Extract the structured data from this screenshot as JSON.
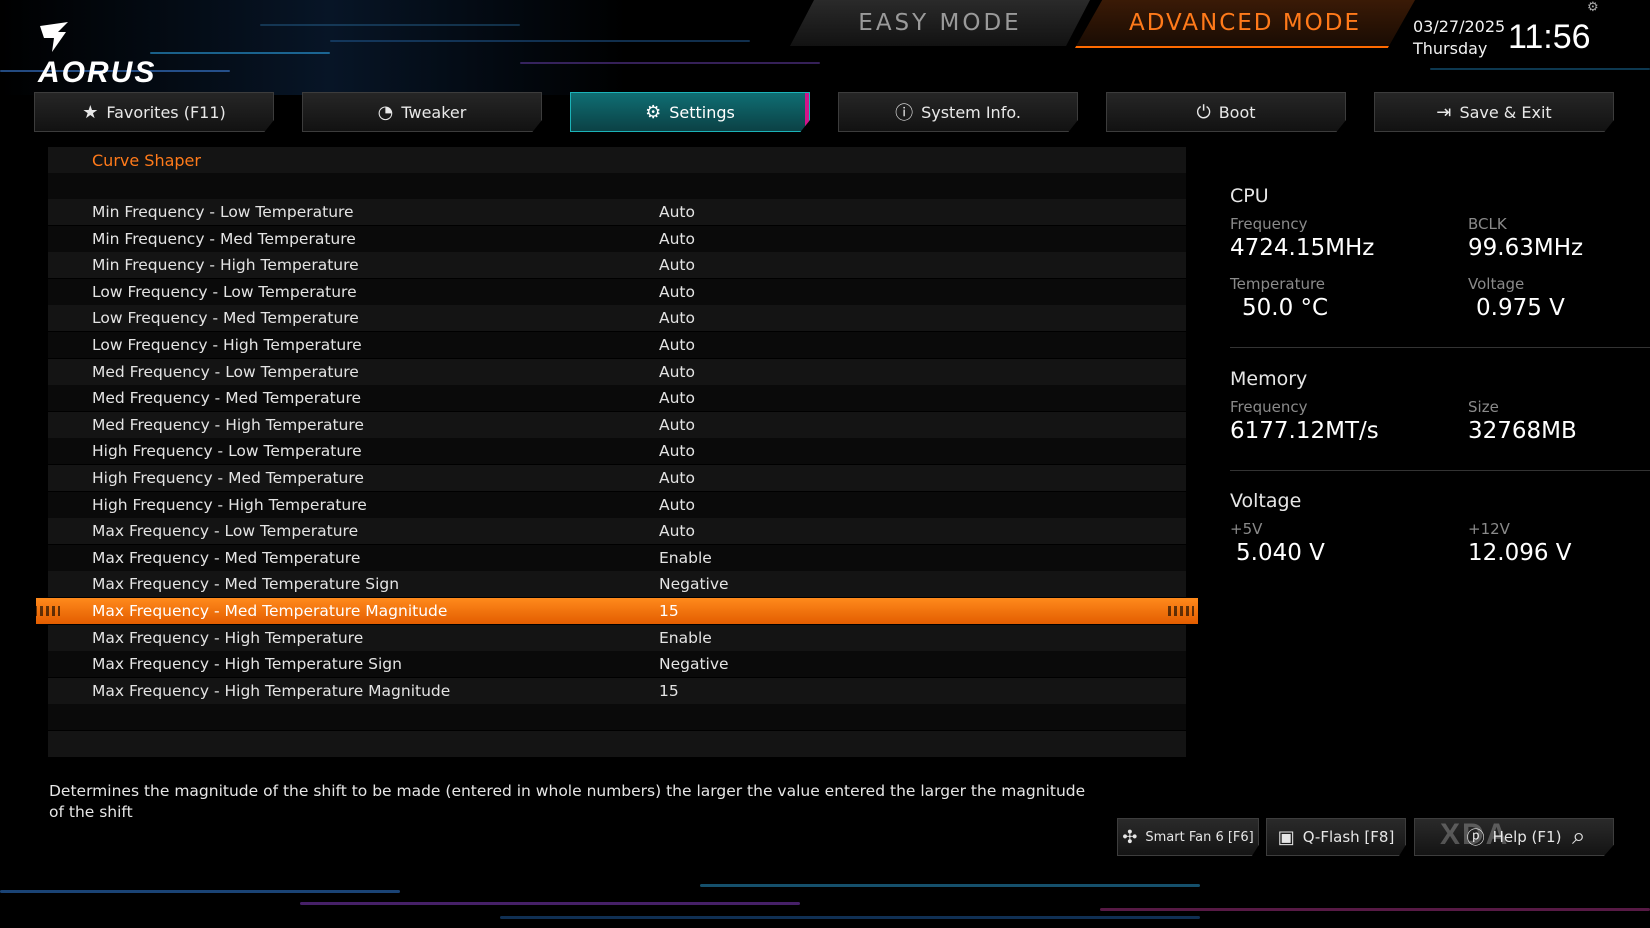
{
  "header": {
    "logo_text": "AORUS",
    "easy_mode_label": "EASY MODE",
    "advanced_mode_label": "ADVANCED MODE",
    "date": "03/27/2025",
    "weekday": "Thursday",
    "time": "11:56"
  },
  "tabs": [
    {
      "label": "Favorites (F11)",
      "icon": "star-icon"
    },
    {
      "label": "Tweaker",
      "icon": "gauge-icon"
    },
    {
      "label": "Settings",
      "icon": "gear-icon",
      "active": true
    },
    {
      "label": "System Info.",
      "icon": "info-icon"
    },
    {
      "label": "Boot",
      "icon": "power-icon"
    },
    {
      "label": "Save & Exit",
      "icon": "exit-icon"
    }
  ],
  "settings": {
    "section_title": "Curve Shaper",
    "selected_index": 15,
    "rows": [
      {
        "name": "Min Frequency - Low Temperature",
        "value": "Auto"
      },
      {
        "name": "Min Frequency - Med Temperature",
        "value": "Auto"
      },
      {
        "name": "Min Frequency - High Temperature",
        "value": "Auto"
      },
      {
        "name": "Low Frequency - Low Temperature",
        "value": "Auto"
      },
      {
        "name": "Low Frequency - Med Temperature",
        "value": "Auto"
      },
      {
        "name": "Low Frequency - High Temperature",
        "value": "Auto"
      },
      {
        "name": "Med Frequency - Low Temperature",
        "value": "Auto"
      },
      {
        "name": "Med Frequency - Med Temperature",
        "value": "Auto"
      },
      {
        "name": "Med Frequency - High Temperature",
        "value": "Auto"
      },
      {
        "name": "High Frequency - Low Temperature",
        "value": "Auto"
      },
      {
        "name": "High Frequency - Med Temperature",
        "value": "Auto"
      },
      {
        "name": "High Frequency - High Temperature",
        "value": "Auto"
      },
      {
        "name": "Max Frequency - Low Temperature",
        "value": "Auto"
      },
      {
        "name": "Max Frequency - Med Temperature",
        "value": "Enable"
      },
      {
        "name": "Max Frequency - Med Temperature Sign",
        "value": "Negative"
      },
      {
        "name": "Max Frequency - Med Temperature Magnitude",
        "value": "15"
      },
      {
        "name": "Max Frequency - High Temperature",
        "value": "Enable"
      },
      {
        "name": "Max Frequency - High Temperature Sign",
        "value": "Negative"
      },
      {
        "name": "Max Frequency - High Temperature Magnitude",
        "value": "15"
      }
    ]
  },
  "help_text": "Determines the magnitude of the shift to be made (entered in whole numbers) the larger the value entered the larger the magnitude of the shift",
  "info": {
    "cpu": {
      "title": "CPU",
      "frequency_label": "Frequency",
      "frequency": "4724.15MHz",
      "bclk_label": "BCLK",
      "bclk": "99.63MHz",
      "temperature_label": "Temperature",
      "temperature": "50.0 °C",
      "voltage_label": "Voltage",
      "voltage": "0.975 V"
    },
    "memory": {
      "title": "Memory",
      "frequency_label": "Frequency",
      "frequency": "6177.12MT/s",
      "size_label": "Size",
      "size": "32768MB"
    },
    "voltage": {
      "title": "Voltage",
      "v5_label": "+5V",
      "v5": "5.040 V",
      "v12_label": "+12V",
      "v12": "12.096 V"
    }
  },
  "bottom_buttons": [
    {
      "label": "Smart Fan 6 [F6]",
      "icon": "fan-icon"
    },
    {
      "label": "Q-Flash [F8]",
      "icon": "chip-icon"
    },
    {
      "label": "Help (F1)",
      "icon": "help-icon"
    }
  ],
  "watermark": "XDA",
  "colors": {
    "accent_orange": "#ff7a1a",
    "active_tab_teal": "#0f6e73",
    "active_tab_magenta": "#d0148a"
  }
}
